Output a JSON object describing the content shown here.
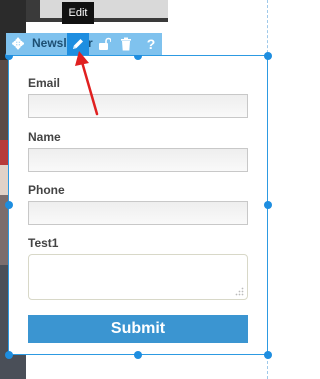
{
  "toolbar": {
    "module_title": "Newsletter",
    "tooltip": "Edit",
    "icons": [
      "move-icon",
      "pencil-icon",
      "unlock-icon",
      "trash-icon",
      "help-icon"
    ]
  },
  "form": {
    "email_label": "Email",
    "name_label": "Name",
    "phone_label": "Phone",
    "test1_label": "Test1",
    "submit_label": "Submit"
  },
  "colors": {
    "accent": "#1e8ee0",
    "toolbar_bg": "#7fc2ee",
    "submit_bg": "#3b95d1",
    "annotation_arrow": "#e02020"
  }
}
